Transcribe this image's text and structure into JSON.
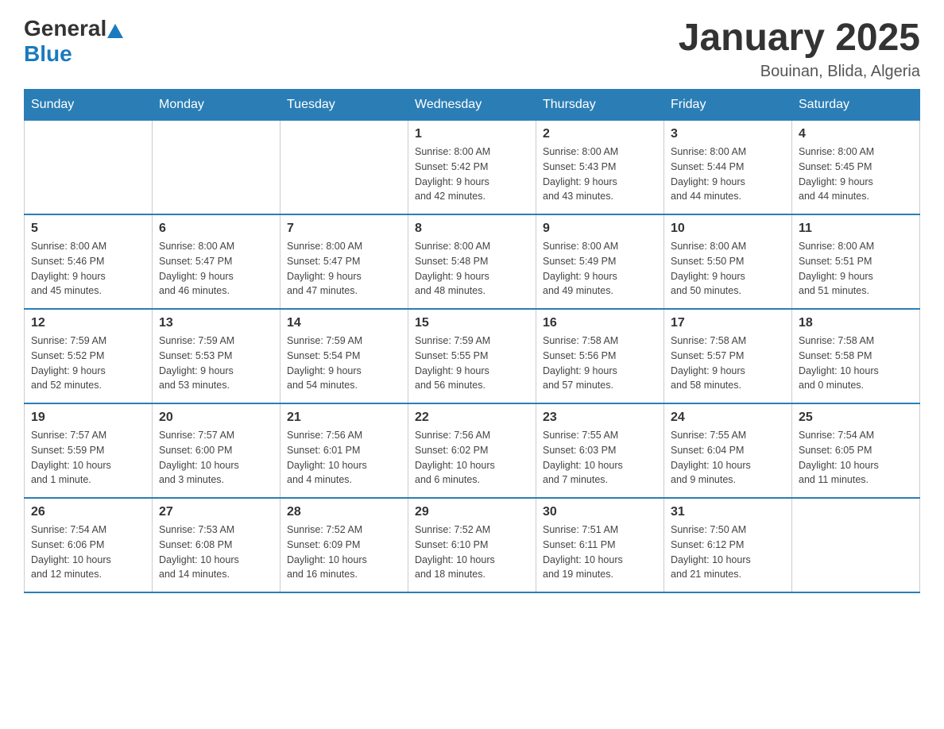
{
  "logo": {
    "text_general": "General",
    "text_blue": "Blue"
  },
  "title": "January 2025",
  "subtitle": "Bouinan, Blida, Algeria",
  "headers": [
    "Sunday",
    "Monday",
    "Tuesday",
    "Wednesday",
    "Thursday",
    "Friday",
    "Saturday"
  ],
  "weeks": [
    [
      {
        "day": "",
        "info": ""
      },
      {
        "day": "",
        "info": ""
      },
      {
        "day": "",
        "info": ""
      },
      {
        "day": "1",
        "info": "Sunrise: 8:00 AM\nSunset: 5:42 PM\nDaylight: 9 hours\nand 42 minutes."
      },
      {
        "day": "2",
        "info": "Sunrise: 8:00 AM\nSunset: 5:43 PM\nDaylight: 9 hours\nand 43 minutes."
      },
      {
        "day": "3",
        "info": "Sunrise: 8:00 AM\nSunset: 5:44 PM\nDaylight: 9 hours\nand 44 minutes."
      },
      {
        "day": "4",
        "info": "Sunrise: 8:00 AM\nSunset: 5:45 PM\nDaylight: 9 hours\nand 44 minutes."
      }
    ],
    [
      {
        "day": "5",
        "info": "Sunrise: 8:00 AM\nSunset: 5:46 PM\nDaylight: 9 hours\nand 45 minutes."
      },
      {
        "day": "6",
        "info": "Sunrise: 8:00 AM\nSunset: 5:47 PM\nDaylight: 9 hours\nand 46 minutes."
      },
      {
        "day": "7",
        "info": "Sunrise: 8:00 AM\nSunset: 5:47 PM\nDaylight: 9 hours\nand 47 minutes."
      },
      {
        "day": "8",
        "info": "Sunrise: 8:00 AM\nSunset: 5:48 PM\nDaylight: 9 hours\nand 48 minutes."
      },
      {
        "day": "9",
        "info": "Sunrise: 8:00 AM\nSunset: 5:49 PM\nDaylight: 9 hours\nand 49 minutes."
      },
      {
        "day": "10",
        "info": "Sunrise: 8:00 AM\nSunset: 5:50 PM\nDaylight: 9 hours\nand 50 minutes."
      },
      {
        "day": "11",
        "info": "Sunrise: 8:00 AM\nSunset: 5:51 PM\nDaylight: 9 hours\nand 51 minutes."
      }
    ],
    [
      {
        "day": "12",
        "info": "Sunrise: 7:59 AM\nSunset: 5:52 PM\nDaylight: 9 hours\nand 52 minutes."
      },
      {
        "day": "13",
        "info": "Sunrise: 7:59 AM\nSunset: 5:53 PM\nDaylight: 9 hours\nand 53 minutes."
      },
      {
        "day": "14",
        "info": "Sunrise: 7:59 AM\nSunset: 5:54 PM\nDaylight: 9 hours\nand 54 minutes."
      },
      {
        "day": "15",
        "info": "Sunrise: 7:59 AM\nSunset: 5:55 PM\nDaylight: 9 hours\nand 56 minutes."
      },
      {
        "day": "16",
        "info": "Sunrise: 7:58 AM\nSunset: 5:56 PM\nDaylight: 9 hours\nand 57 minutes."
      },
      {
        "day": "17",
        "info": "Sunrise: 7:58 AM\nSunset: 5:57 PM\nDaylight: 9 hours\nand 58 minutes."
      },
      {
        "day": "18",
        "info": "Sunrise: 7:58 AM\nSunset: 5:58 PM\nDaylight: 10 hours\nand 0 minutes."
      }
    ],
    [
      {
        "day": "19",
        "info": "Sunrise: 7:57 AM\nSunset: 5:59 PM\nDaylight: 10 hours\nand 1 minute."
      },
      {
        "day": "20",
        "info": "Sunrise: 7:57 AM\nSunset: 6:00 PM\nDaylight: 10 hours\nand 3 minutes."
      },
      {
        "day": "21",
        "info": "Sunrise: 7:56 AM\nSunset: 6:01 PM\nDaylight: 10 hours\nand 4 minutes."
      },
      {
        "day": "22",
        "info": "Sunrise: 7:56 AM\nSunset: 6:02 PM\nDaylight: 10 hours\nand 6 minutes."
      },
      {
        "day": "23",
        "info": "Sunrise: 7:55 AM\nSunset: 6:03 PM\nDaylight: 10 hours\nand 7 minutes."
      },
      {
        "day": "24",
        "info": "Sunrise: 7:55 AM\nSunset: 6:04 PM\nDaylight: 10 hours\nand 9 minutes."
      },
      {
        "day": "25",
        "info": "Sunrise: 7:54 AM\nSunset: 6:05 PM\nDaylight: 10 hours\nand 11 minutes."
      }
    ],
    [
      {
        "day": "26",
        "info": "Sunrise: 7:54 AM\nSunset: 6:06 PM\nDaylight: 10 hours\nand 12 minutes."
      },
      {
        "day": "27",
        "info": "Sunrise: 7:53 AM\nSunset: 6:08 PM\nDaylight: 10 hours\nand 14 minutes."
      },
      {
        "day": "28",
        "info": "Sunrise: 7:52 AM\nSunset: 6:09 PM\nDaylight: 10 hours\nand 16 minutes."
      },
      {
        "day": "29",
        "info": "Sunrise: 7:52 AM\nSunset: 6:10 PM\nDaylight: 10 hours\nand 18 minutes."
      },
      {
        "day": "30",
        "info": "Sunrise: 7:51 AM\nSunset: 6:11 PM\nDaylight: 10 hours\nand 19 minutes."
      },
      {
        "day": "31",
        "info": "Sunrise: 7:50 AM\nSunset: 6:12 PM\nDaylight: 10 hours\nand 21 minutes."
      },
      {
        "day": "",
        "info": ""
      }
    ]
  ]
}
